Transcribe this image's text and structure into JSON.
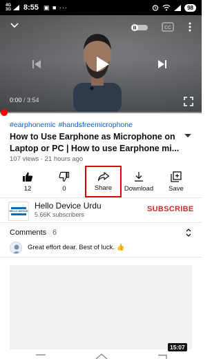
{
  "status_bar": {
    "net1": "4G",
    "net2": "3G",
    "time": "8:55",
    "indicators": "▣ ■ ···",
    "battery": "98"
  },
  "player": {
    "current_time": "0:00",
    "separator": " / ",
    "duration": "3:54",
    "progress_fraction": 0.0,
    "icons": [
      "chevron-down-icon",
      "autoplay-toggle-icon",
      "captions-icon",
      "more-vert-icon",
      "previous-icon",
      "play-icon",
      "next-icon",
      "fullscreen-icon"
    ]
  },
  "video": {
    "hashtags": [
      "#earphonemic",
      "#handsfreemicrophone"
    ],
    "title": "How to Use Earphone as Microphone on Laptop or PC | How to use Earphone mi...",
    "meta": "107 views · 21 hours ago"
  },
  "actions": {
    "like_count": "12",
    "dislike_count": "0",
    "share_label": "Share",
    "download_label": "Download",
    "save_label": "Save"
  },
  "channel": {
    "name": "Hello Device Urdu",
    "subscribers": "5.66K subscribers",
    "subscribe_label": "SUBSCRIBE",
    "avatar_text": "HELLO DEVICE"
  },
  "comments": {
    "heading": "Comments",
    "count": "6",
    "top_comment": "Great effort dear. Best of luck. 👍"
  },
  "next_video": {
    "duration": "15:07"
  },
  "colors": {
    "accent_red": "#ff0000",
    "link_blue": "#065fd4",
    "subscribe_red": "#c4302b",
    "highlight_box": "#d90000"
  }
}
